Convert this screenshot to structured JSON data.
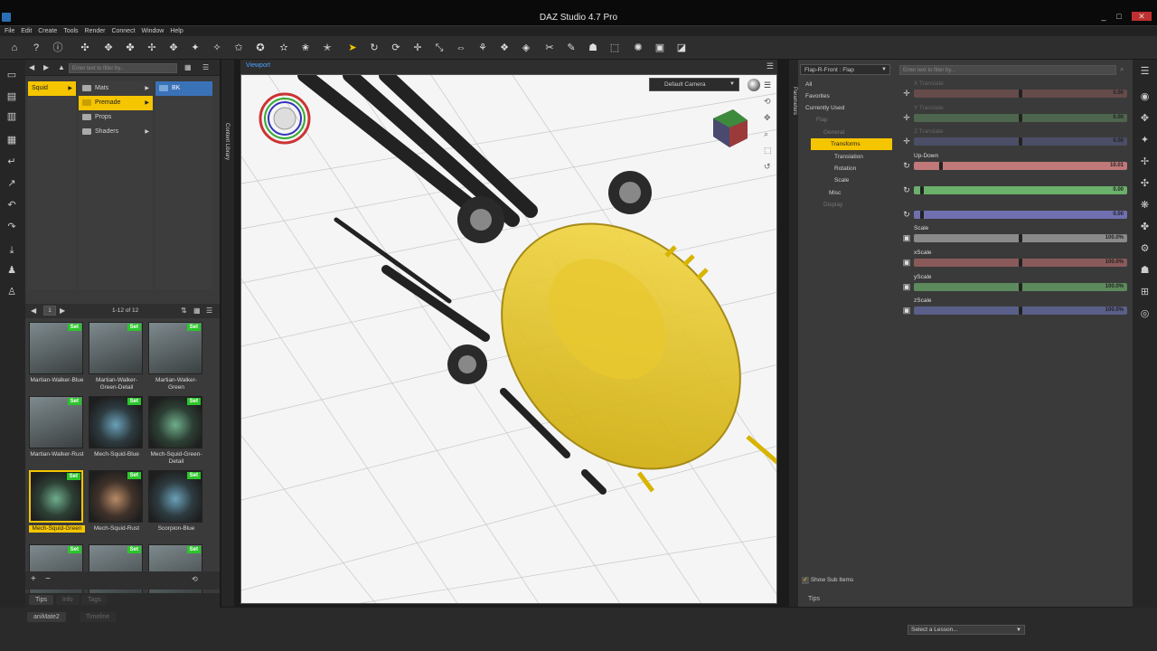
{
  "window": {
    "title": "DAZ Studio 4.7 Pro",
    "min": "_",
    "max": "□",
    "close": "✕"
  },
  "menu": [
    "File",
    "Edit",
    "Create",
    "Tools",
    "Render",
    "Connect",
    "Window",
    "Help"
  ],
  "content_library": {
    "search_placeholder": "Enter text to filter by...",
    "vtab": "Content Library",
    "col1": [
      {
        "label": "Squid",
        "selected": true
      }
    ],
    "col2": [
      {
        "label": "Mats",
        "selected": false
      },
      {
        "label": "Premade",
        "selected": true
      },
      {
        "label": "Props",
        "selected": false
      },
      {
        "label": "Shaders",
        "selected": false
      }
    ],
    "col3": [
      {
        "label": "BK",
        "selected": true
      }
    ],
    "page": "1",
    "count": "1-12 of 12",
    "thumbs": [
      {
        "label": "Martian-Walker-Blue",
        "badge": "Set"
      },
      {
        "label": "Martian-Walker-Green-Detail",
        "badge": "Set"
      },
      {
        "label": "Martian-Walker-Green",
        "badge": "Set"
      },
      {
        "label": "Martian-Walker-Rust",
        "badge": "Set"
      },
      {
        "label": "Mech-Squid-Blue",
        "badge": "Set"
      },
      {
        "label": "Mech-Squid-Green-Detail",
        "badge": "Set"
      },
      {
        "label": "Mech-Squid-Green",
        "badge": "Set"
      },
      {
        "label": "Mech-Squid-Rust",
        "badge": "Set"
      },
      {
        "label": "Scorpion-Blue",
        "badge": "Set"
      },
      {
        "label": "",
        "badge": "Set"
      },
      {
        "label": "",
        "badge": "Set"
      },
      {
        "label": "",
        "badge": "Set"
      }
    ],
    "tabs": [
      "Tips",
      "Info",
      "Tags"
    ]
  },
  "viewport": {
    "tab": "Viewport",
    "camera": "Default Camera"
  },
  "parameters": {
    "vtab": "Parameters",
    "node_select": "Flap-R-Front : Flap",
    "search_placeholder": "Enter text to filter by...",
    "tree": [
      {
        "label": "All",
        "dim": false,
        "hl": false
      },
      {
        "label": "Favorites",
        "dim": false,
        "hl": false
      },
      {
        "label": "Currently Used",
        "dim": false,
        "hl": false
      },
      {
        "label": "Flap",
        "dim": true,
        "hl": false
      },
      {
        "label": "General",
        "dim": true,
        "hl": false
      },
      {
        "label": "Transforms",
        "dim": false,
        "hl": true
      },
      {
        "label": "Translation",
        "dim": false,
        "hl": false
      },
      {
        "label": "Rotation",
        "dim": false,
        "hl": false
      },
      {
        "label": "Scale",
        "dim": false,
        "hl": false
      },
      {
        "label": "Misc",
        "dim": false,
        "hl": false
      },
      {
        "label": "Display",
        "dim": true,
        "hl": false
      }
    ],
    "show_sub_items": "Show Sub Items",
    "tips_tab": "Tips",
    "sliders": [
      {
        "name": "X Translate",
        "value": "0.00",
        "color": "#8a5a5a",
        "dim": true,
        "icon": "translate-icon",
        "knob": 0.5
      },
      {
        "name": "Y Translate",
        "value": "0.00",
        "color": "#5c8a5c",
        "dim": true,
        "icon": "translate-icon",
        "knob": 0.5
      },
      {
        "name": "Z Translate",
        "value": "0.00",
        "color": "#5a5f8a",
        "dim": true,
        "icon": "translate-icon",
        "knob": 0.5
      },
      {
        "name": "Up-Down",
        "value": "10.01",
        "color": "#c07878",
        "dim": false,
        "icon": "rotate-icon",
        "knob": 0.12
      },
      {
        "name": "",
        "value": "0.00",
        "color": "#6bb06b",
        "dim": false,
        "icon": "rotate-icon",
        "knob": 0.03
      },
      {
        "name": "",
        "value": "0.00",
        "color": "#7070b0",
        "dim": false,
        "icon": "rotate-icon",
        "knob": 0.03
      },
      {
        "name": "Scale",
        "value": "100.0%",
        "color": "#8a8a8a",
        "dim": false,
        "icon": "scale-icon",
        "knob": 0.5
      },
      {
        "name": "xScale",
        "value": "100.0%",
        "color": "#8a5a5a",
        "dim": false,
        "icon": "scale-icon",
        "knob": 0.5
      },
      {
        "name": "yScale",
        "value": "100.0%",
        "color": "#5c8a5c",
        "dim": false,
        "icon": "scale-icon",
        "knob": 0.5
      },
      {
        "name": "zScale",
        "value": "100.0%",
        "color": "#5a5f8a",
        "dim": false,
        "icon": "scale-icon",
        "knob": 0.5
      }
    ]
  },
  "bottom": {
    "tabs": [
      "aniMate2",
      "Timeline"
    ],
    "lesson": "Select a Lesson..."
  },
  "colors": {
    "accent": "#f5c500",
    "select_blue": "#3a72b8",
    "set_badge": "#2bc52b"
  }
}
